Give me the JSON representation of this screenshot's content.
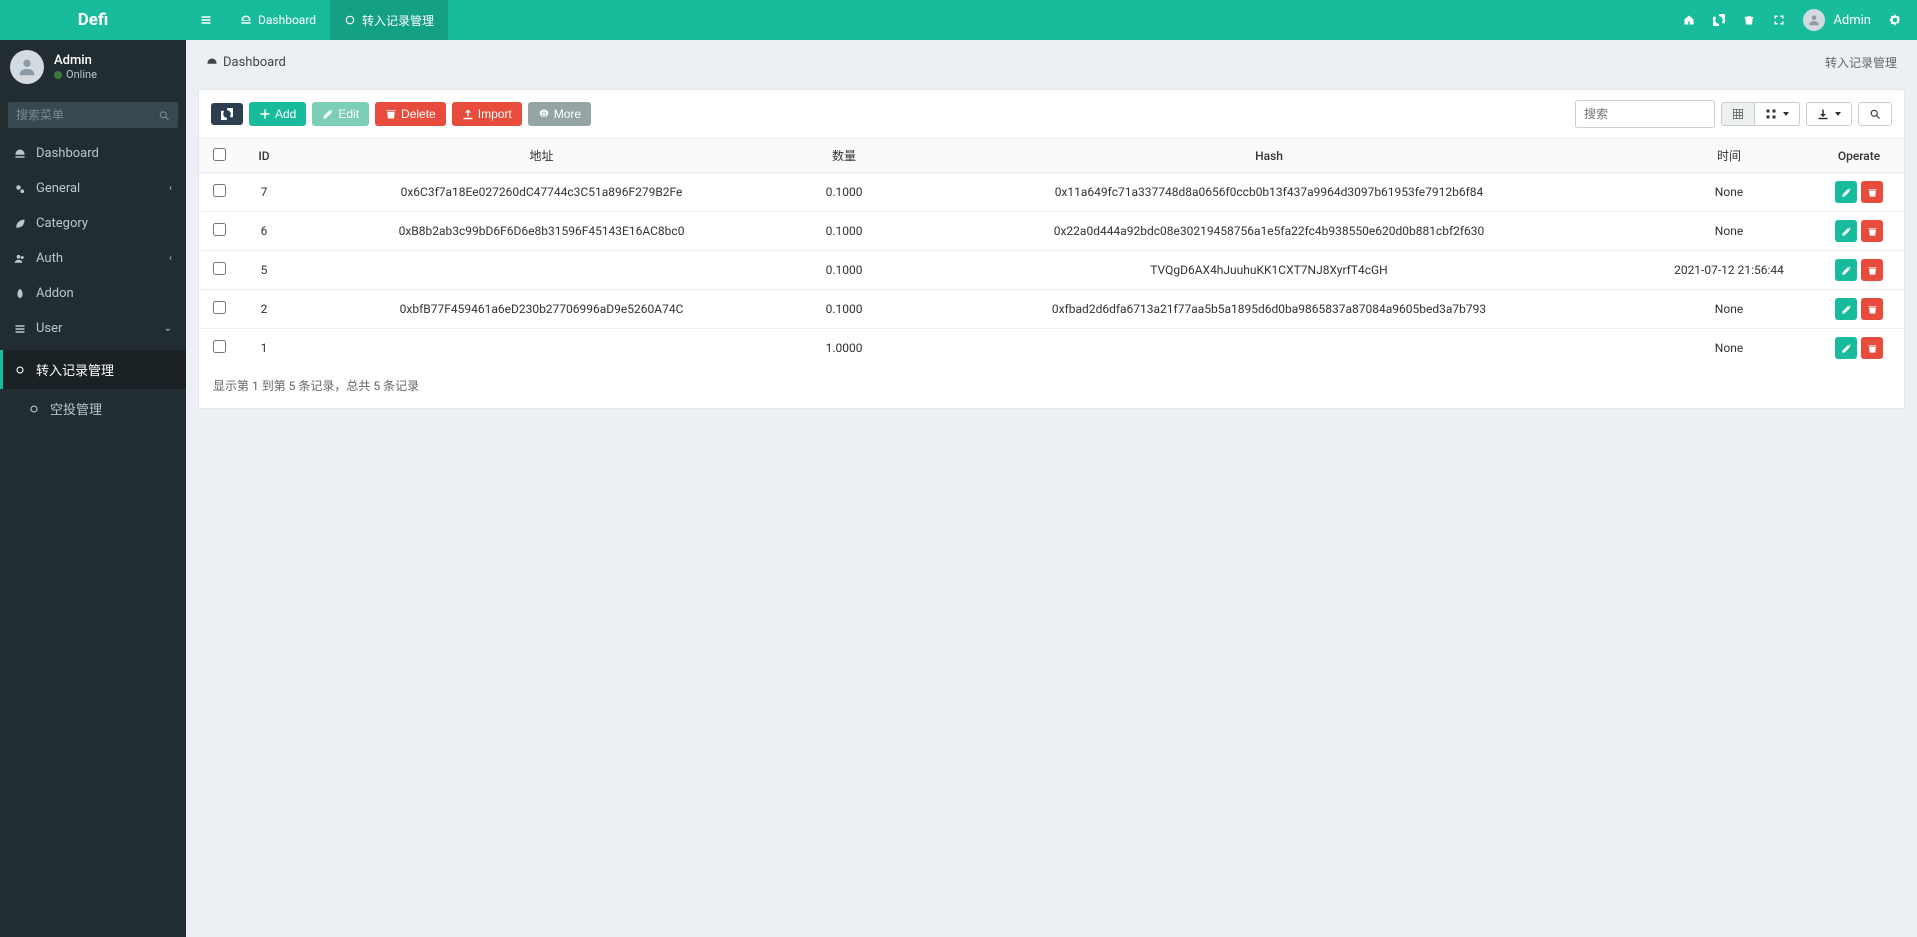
{
  "brand": "Defi",
  "header": {
    "tabs": [
      {
        "label": "Dashboard",
        "active": false
      },
      {
        "label": "转入记录管理",
        "active": true
      }
    ],
    "user_label": "Admin"
  },
  "sidebar": {
    "user_name": "Admin",
    "user_status": "Online",
    "search_placeholder": "搜索菜单",
    "menu": [
      {
        "label": "Dashboard",
        "icon": "dashboard",
        "expandable": false
      },
      {
        "label": "General",
        "icon": "cogs",
        "expandable": true
      },
      {
        "label": "Category",
        "icon": "leaf",
        "expandable": false
      },
      {
        "label": "Auth",
        "icon": "users",
        "expandable": true
      },
      {
        "label": "Addon",
        "icon": "rocket",
        "expandable": false
      },
      {
        "label": "User",
        "icon": "list",
        "expandable": true,
        "expanded": true
      }
    ],
    "submenu": [
      {
        "label": "转入记录管理",
        "active": true
      },
      {
        "label": "空投管理",
        "active": false
      }
    ]
  },
  "breadcrumb": {
    "home": "Dashboard",
    "current": "转入记录管理"
  },
  "toolbar": {
    "add": "Add",
    "edit": "Edit",
    "delete": "Delete",
    "import": "Import",
    "more": "More",
    "search_placeholder": "搜索"
  },
  "table": {
    "headers": {
      "id": "ID",
      "address": "地址",
      "amount": "数量",
      "hash": "Hash",
      "time": "时间",
      "operate": "Operate"
    },
    "rows": [
      {
        "id": "7",
        "address": "0x6C3f7a18Ee027260dC47744c3C51a896F279B2Fe",
        "amount": "0.1000",
        "hash": "0x11a649fc71a337748d8a0656f0ccb0b13f437a9964d3097b61953fe7912b6f84",
        "time": "None"
      },
      {
        "id": "6",
        "address": "0xB8b2ab3c99bD6F6D6e8b31596F45143E16AC8bc0",
        "amount": "0.1000",
        "hash": "0x22a0d444a92bdc08e30219458756a1e5fa22fc4b938550e620d0b881cbf2f630",
        "time": "None"
      },
      {
        "id": "5",
        "address": "",
        "amount": "0.1000",
        "hash": "TVQgD6AX4hJuuhuKK1CXT7NJ8XyrfT4cGH",
        "time": "2021-07-12 21:56:44"
      },
      {
        "id": "2",
        "address": "0xbfB77F459461a6eD230b27706996aD9e5260A74C",
        "amount": "0.1000",
        "hash": "0xfbad2d6dfa6713a21f77aa5b5a1895d6d0ba9865837a87084a9605bed3a7b793",
        "time": "None"
      },
      {
        "id": "1",
        "address": "",
        "amount": "1.0000",
        "hash": "",
        "time": "None"
      }
    ]
  },
  "pager_text": "显示第 1 到第 5 条记录，总共 5 条记录"
}
